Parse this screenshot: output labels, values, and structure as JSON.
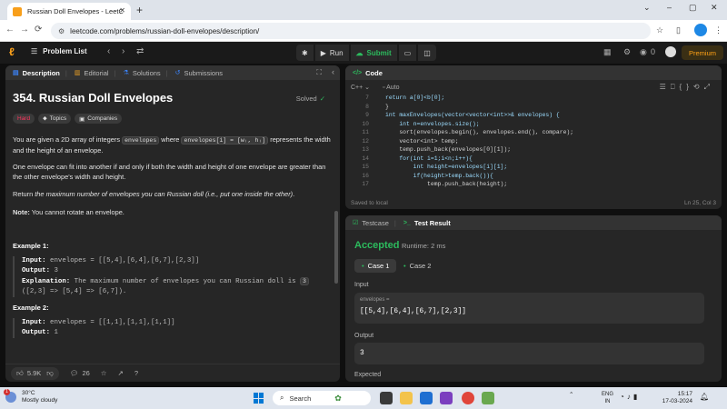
{
  "browser": {
    "tab_title": "Russian Doll Envelopes - LeetC",
    "tab_close": "✕",
    "new_tab": "+",
    "window_controls": [
      "⌄",
      "–",
      "▢",
      "✕"
    ],
    "nav": [
      "←",
      "→",
      "⟳"
    ],
    "url": "leetcode.com/problems/russian-doll-envelopes/description/",
    "right_icons": [
      "☆",
      "▯",
      "⋮"
    ]
  },
  "header": {
    "problem_list": "Problem List",
    "run": "Run",
    "submit": "Submit",
    "fire_count": "0",
    "premium": "Premium"
  },
  "left_tabs": [
    {
      "icon": "▤",
      "label": "Description"
    },
    {
      "icon": "▥",
      "label": "Editorial"
    },
    {
      "icon": "⚗",
      "label": "Solutions"
    },
    {
      "icon": "↺",
      "label": "Submissions"
    }
  ],
  "problem": {
    "title": "354. Russian Doll Envelopes",
    "status": "Solved",
    "difficulty": "Hard",
    "topics_label": "Topics",
    "companies_label": "Companies",
    "p1_a": "You are given a 2D array of integers ",
    "p1_code1": "envelopes",
    "p1_b": " where ",
    "p1_code2": "envelopes[i] = [wᵢ, hᵢ]",
    "p1_c": " represents the width and the height of an envelope.",
    "p2": "One envelope can fit into another if and only if both the width and height of one envelope are greater than the other envelope's width and height.",
    "p3_a": "Return ",
    "p3_em": "the maximum number of envelopes you can Russian doll (i.e., put one inside the other)",
    "p3_b": ".",
    "note_b": "Note:",
    "note": " You cannot rotate an envelope.",
    "ex1_title": "Example 1:",
    "ex1_input_label": "Input:",
    "ex1_input": " envelopes = [[5,4],[6,4],[6,7],[2,3]]",
    "ex1_output_label": "Output:",
    "ex1_output": " 3",
    "ex1_expl_label": "Explanation:",
    "ex1_expl": " The maximum number of envelopes you can Russian doll is ",
    "ex1_expl_code": "3",
    "ex1_expl2": "([2,3] => [5,4] => [6,7]).",
    "ex2_title": "Example 2:",
    "ex2_input_label": "Input:",
    "ex2_input": " envelopes = [[1,1],[1,1],[1,1]]",
    "ex2_output_label": "Output:",
    "ex2_output": " 1"
  },
  "left_footer": {
    "likes": "5.9K",
    "comments": "26"
  },
  "code_panel": {
    "title": "Code",
    "language": "C++",
    "auto_label": "Auto",
    "lines": [
      {
        "n": "7",
        "text": "return a[0]<b[0];"
      },
      {
        "n": "8",
        "text": "}"
      },
      {
        "n": "9",
        "text": "int maxEnvelopes(vector<vector<int>>& envelopes) {"
      },
      {
        "n": "10",
        "text": "    int n=envelopes.size();"
      },
      {
        "n": "11",
        "text": "    sort(envelopes.begin(), envelopes.end(), compare);"
      },
      {
        "n": "12",
        "text": "    vector<int> temp;"
      },
      {
        "n": "13",
        "text": "    temp.push_back(envelopes[0][1]);"
      },
      {
        "n": "14",
        "text": "    for(int i=1;i<n;i++){"
      },
      {
        "n": "15",
        "text": "        int height=envelopes[i][1];"
      },
      {
        "n": "16",
        "text": "        if(height>temp.back()){"
      },
      {
        "n": "17",
        "text": "            temp.push_back(height);"
      }
    ],
    "saved": "Saved to local",
    "cursor": "Ln 25, Col 3"
  },
  "result_panel": {
    "tab_testcase": "Testcase",
    "tab_result": "Test Result",
    "verdict": "Accepted",
    "runtime": "Runtime: 2 ms",
    "cases": [
      "Case 1",
      "Case 2"
    ],
    "input_label": "Input",
    "input_name": "envelopes =",
    "input_value": "[[5,4],[6,4],[6,7],[2,3]]",
    "output_label": "Output",
    "output_value": "3",
    "expected_label": "Expected"
  },
  "taskbar": {
    "weather_temp": "30°C",
    "weather_desc": "Mostly cloudy",
    "weather_badge": "1",
    "search": "Search",
    "lang1": "ENG",
    "lang2": "IN",
    "time": "15:17",
    "date": "17-03-2024"
  }
}
